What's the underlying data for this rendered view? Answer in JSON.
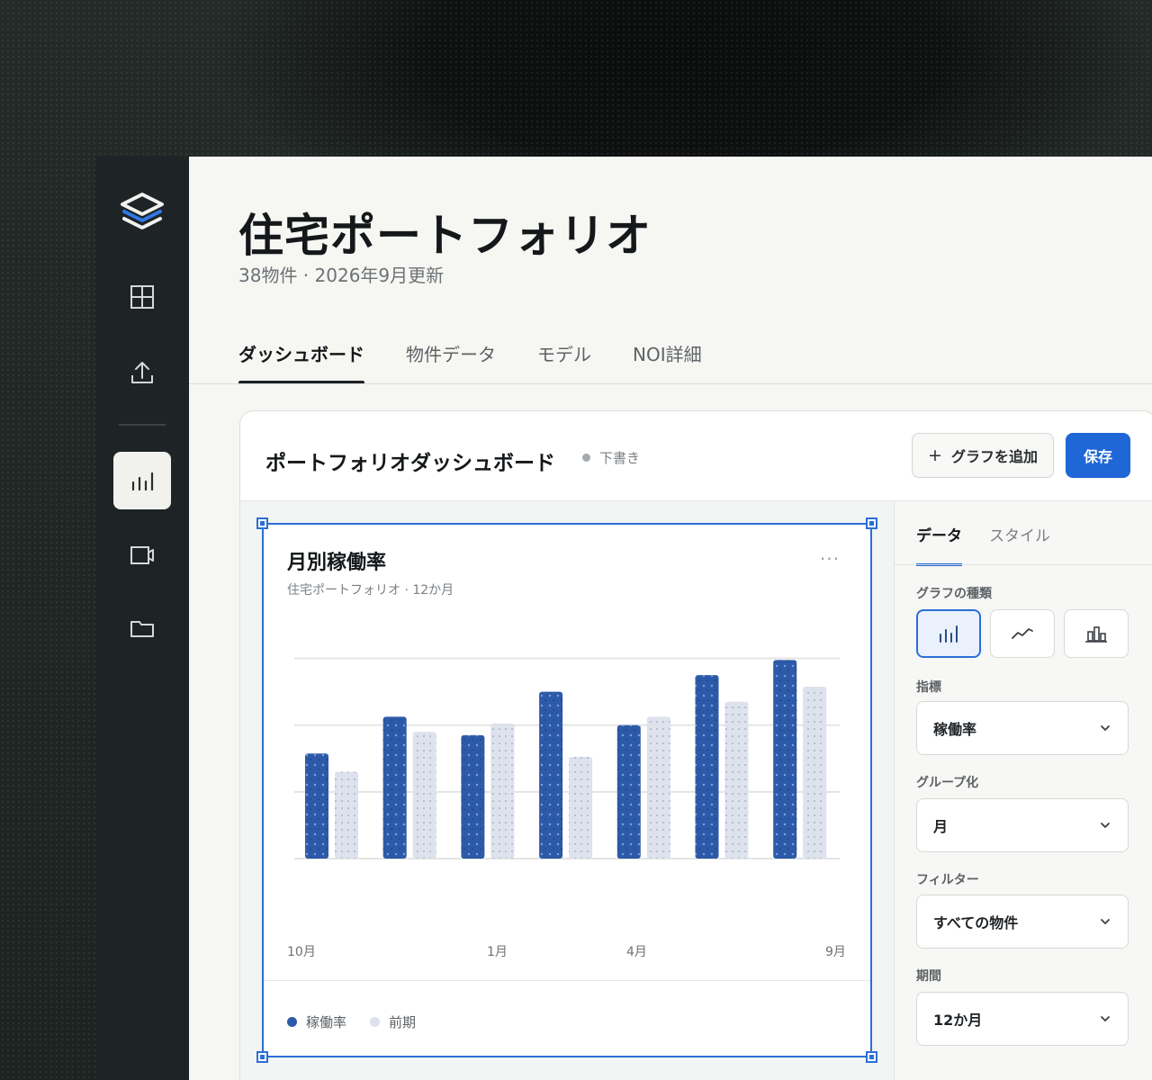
{
  "page": {
    "title": "住宅ポートフォリオ",
    "subtitle": "38物件 · 2026年9月更新"
  },
  "sidebar": {
    "icons": [
      "layers-logo",
      "grid-icon",
      "upload-icon",
      "bar-chart-icon",
      "video-icon",
      "folder-icon"
    ],
    "active": "bar-chart-icon"
  },
  "tabs": [
    {
      "label": "ダッシュボード",
      "active": true
    },
    {
      "label": "物件データ",
      "active": false
    },
    {
      "label": "モデル",
      "active": false
    },
    {
      "label": "NOI詳細",
      "active": false
    }
  ],
  "dashboard": {
    "title": "ポートフォリオダッシュボード",
    "status": "下書き",
    "add_chart_label": "グラフを追加",
    "save_label": "保存"
  },
  "chart_card": {
    "title": "月別稼働率",
    "subtitle": "住宅ポートフォリオ · 12か月",
    "menu": "···"
  },
  "chart_data": {
    "type": "bar",
    "x_tick_labels": [
      "10月",
      "1月",
      "4月",
      "9月"
    ],
    "series": [
      {
        "name": "稼働率",
        "color": "#2d5aa8",
        "values": [
          63,
          85,
          74,
          100,
          80,
          110,
          119
        ]
      },
      {
        "name": "前期",
        "color": "#dde2ec",
        "values": [
          52,
          76,
          81,
          61,
          85,
          94,
          103
        ]
      }
    ],
    "ylim": [
      0,
      130
    ],
    "grid": true,
    "legend_position": "bottom-left"
  },
  "panel": {
    "tabs": [
      {
        "label": "データ",
        "active": true
      },
      {
        "label": "スタイル",
        "active": false
      }
    ],
    "chart_type_label": "グラフの種類",
    "chart_types": [
      "bar-chart-icon",
      "line-chart-icon",
      "column-chart-icon"
    ],
    "metric_label": "指標",
    "metric_value": "稼働率",
    "group_label": "グループ化",
    "group_value": "月",
    "filter_label": "フィルター",
    "filter_value": "すべての物件",
    "period_label": "期間",
    "period_value": "12か月"
  }
}
